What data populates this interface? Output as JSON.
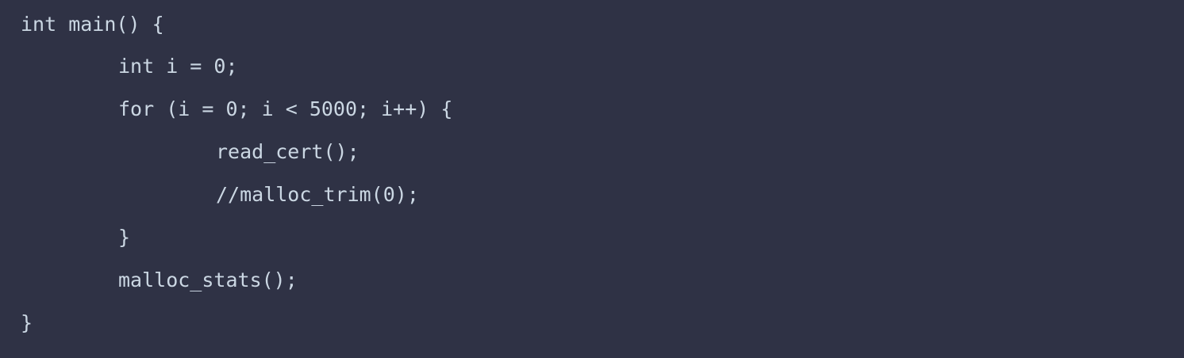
{
  "code": {
    "lines": [
      "int main() {",
      "int i = 0;",
      "for (i = 0; i < 5000; i++) {",
      "read_cert();",
      "//malloc_trim(0);",
      "}",
      "malloc_stats();",
      "}"
    ]
  },
  "colors": {
    "background": "#2f3245",
    "text": "#cbd7e3"
  }
}
